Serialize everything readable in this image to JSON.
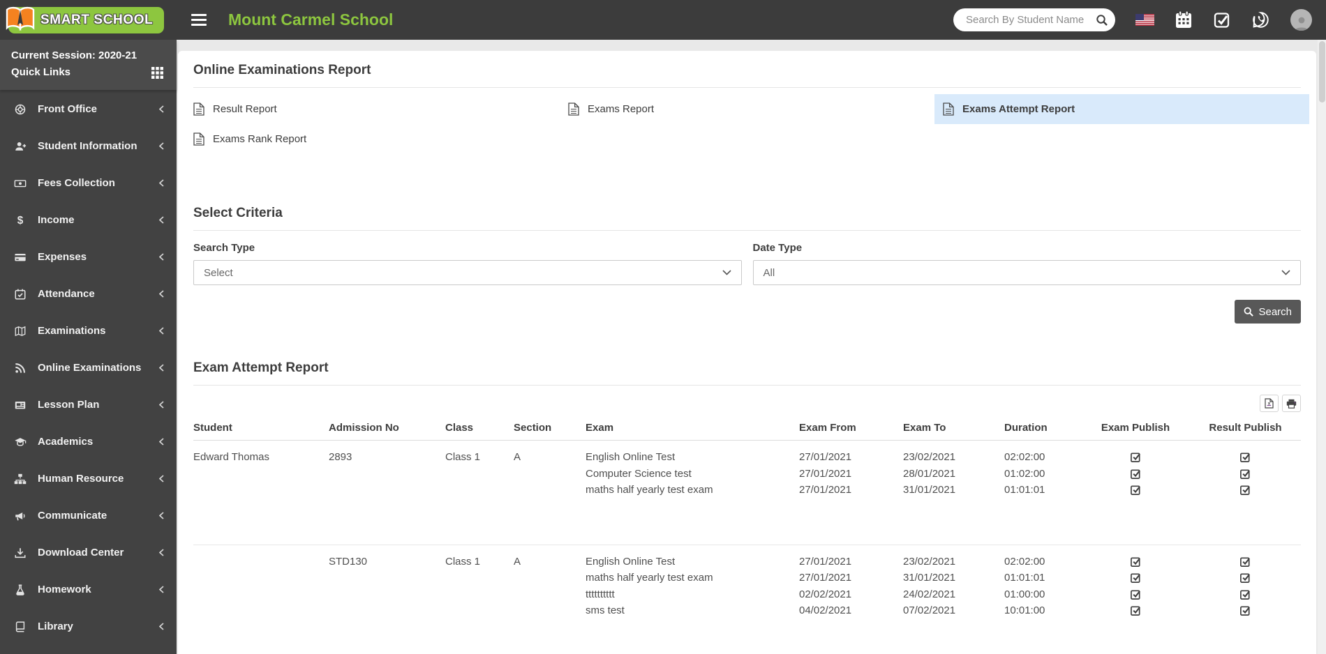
{
  "navbar": {
    "brand": "SMART SCHOOL",
    "title": "Mount Carmel School",
    "search_placeholder": "Search By Student Name"
  },
  "sidebar": {
    "session": "Current Session: 2020-21",
    "quick_links": "Quick Links",
    "items": [
      {
        "label": "Front Office",
        "icon": "life-ring-icon"
      },
      {
        "label": "Student Information",
        "icon": "user-plus-icon"
      },
      {
        "label": "Fees Collection",
        "icon": "money-bill-icon"
      },
      {
        "label": "Income",
        "icon": "dollar-icon"
      },
      {
        "label": "Expenses",
        "icon": "credit-card-icon"
      },
      {
        "label": "Attendance",
        "icon": "calendar-check-icon"
      },
      {
        "label": "Examinations",
        "icon": "map-icon"
      },
      {
        "label": "Online Examinations",
        "icon": "rss-icon"
      },
      {
        "label": "Lesson Plan",
        "icon": "newspaper-icon"
      },
      {
        "label": "Academics",
        "icon": "graduation-cap-icon"
      },
      {
        "label": "Human Resource",
        "icon": "sitemap-icon"
      },
      {
        "label": "Communicate",
        "icon": "bullhorn-icon"
      },
      {
        "label": "Download Center",
        "icon": "download-icon"
      },
      {
        "label": "Homework",
        "icon": "flask-icon"
      },
      {
        "label": "Library",
        "icon": "book-icon"
      }
    ]
  },
  "report_nav": {
    "title": "Online Examinations Report",
    "links": [
      {
        "label": "Result Report",
        "active": false
      },
      {
        "label": "Exams Report",
        "active": false
      },
      {
        "label": "Exams Attempt Report",
        "active": true
      },
      {
        "label": "Exams Rank Report",
        "active": false
      }
    ]
  },
  "criteria": {
    "title": "Select Criteria",
    "search_type_label": "Search Type",
    "search_type_value": "Select",
    "date_type_label": "Date Type",
    "date_type_value": "All",
    "search_button": "Search"
  },
  "attempt_report": {
    "title": "Exam Attempt Report",
    "columns": [
      "Student",
      "Admission No",
      "Class",
      "Section",
      "Exam",
      "Exam From",
      "Exam To",
      "Duration",
      "Exam Publish",
      "Result Publish"
    ],
    "rows": [
      {
        "student": "Edward Thomas",
        "admission_no": "2893",
        "class": "Class 1",
        "section": "A",
        "exams": [
          {
            "name": "English Online Test",
            "from": "27/01/2021",
            "to": "23/02/2021",
            "duration": "02:02:00",
            "exam_publish": true,
            "result_publish": true
          },
          {
            "name": "Computer Science test",
            "from": "27/01/2021",
            "to": "28/01/2021",
            "duration": "01:02:00",
            "exam_publish": true,
            "result_publish": true
          },
          {
            "name": "maths half yearly test exam",
            "from": "27/01/2021",
            "to": "31/01/2021",
            "duration": "01:01:01",
            "exam_publish": true,
            "result_publish": true
          }
        ]
      },
      {
        "student": "",
        "admission_no": "STD130",
        "class": "Class 1",
        "section": "A",
        "exams": [
          {
            "name": "English Online Test",
            "from": "27/01/2021",
            "to": "23/02/2021",
            "duration": "02:02:00",
            "exam_publish": true,
            "result_publish": true
          },
          {
            "name": "maths half yearly test exam",
            "from": "27/01/2021",
            "to": "31/01/2021",
            "duration": "01:01:01",
            "exam_publish": true,
            "result_publish": true
          },
          {
            "name": "tttttttttt",
            "from": "02/02/2021",
            "to": "24/02/2021",
            "duration": "01:00:00",
            "exam_publish": true,
            "result_publish": true
          },
          {
            "name": "sms test",
            "from": "04/02/2021",
            "to": "07/02/2021",
            "duration": "10:01:00",
            "exam_publish": true,
            "result_publish": true
          }
        ]
      }
    ]
  },
  "colors": {
    "accent_green": "#8dc63f",
    "navbar_bg": "#3c3c3c",
    "sidebar_bg": "#424242",
    "active_link_bg": "#d9eafb",
    "button_bg": "#585858"
  }
}
